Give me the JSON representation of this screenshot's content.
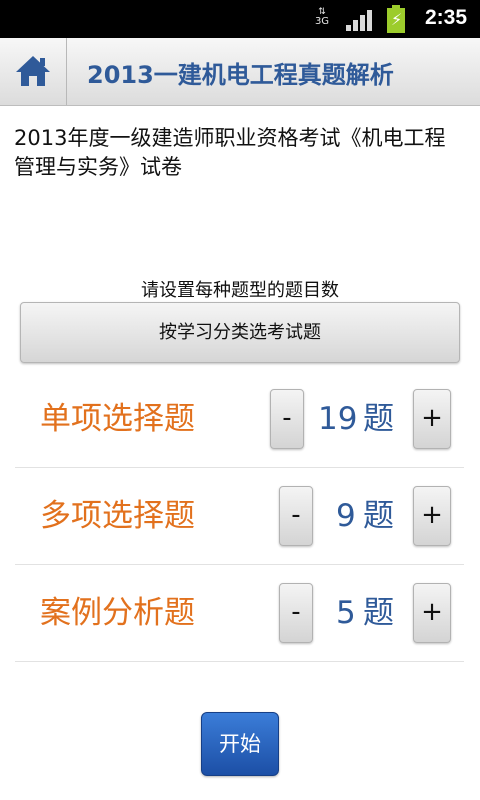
{
  "status_bar": {
    "network": "3G",
    "time": "2:35"
  },
  "header": {
    "home_icon": "home-icon",
    "title": "2013一建机电工程真题解析"
  },
  "exam": {
    "description": "2013年度一级建造师职业资格考试《机电工程管理与实务》试卷"
  },
  "settings": {
    "prompt": "请设置每种题型的题目数",
    "category_button": "按学习分类选考试题"
  },
  "question_types": [
    {
      "label": "单项选择题",
      "count": "19",
      "unit": "题",
      "minus": "-",
      "plus": "+"
    },
    {
      "label": "多项选择题",
      "count": "9",
      "unit": "题",
      "minus": "-",
      "plus": "+"
    },
    {
      "label": "案例分析题",
      "count": "5",
      "unit": "题",
      "minus": "-",
      "plus": "+"
    }
  ],
  "actions": {
    "start": "开始"
  },
  "colors": {
    "accent_blue": "#2f5a99",
    "label_orange": "#e2711d",
    "start_button": "#1c4fa6",
    "battery": "#9ccc2c"
  }
}
